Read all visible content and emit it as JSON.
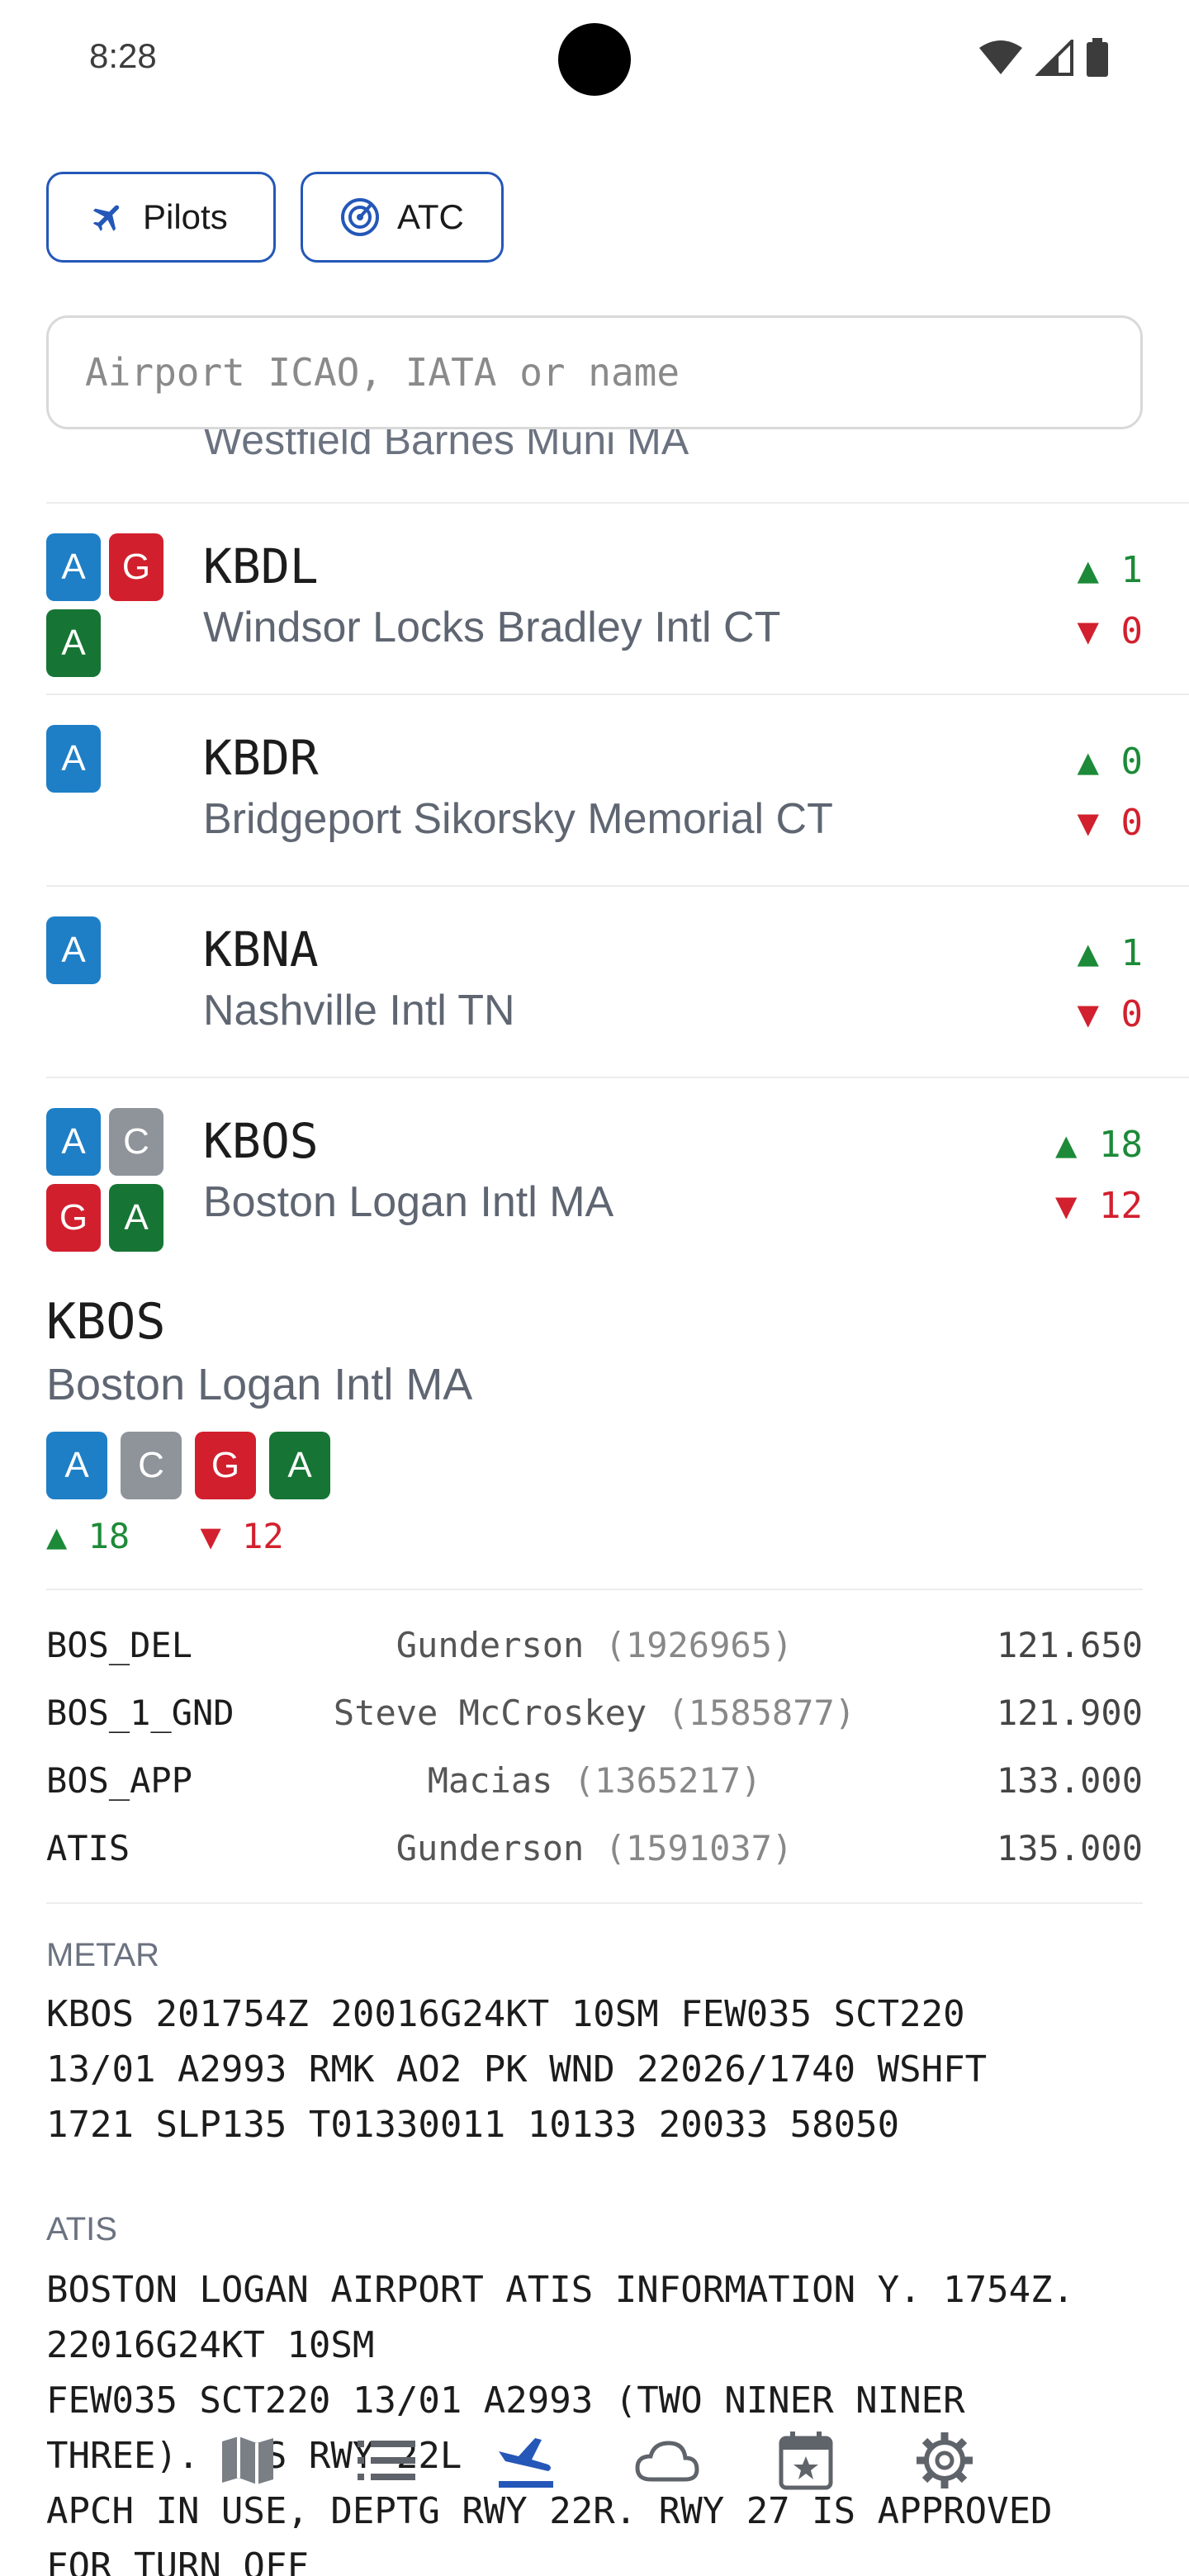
{
  "status": {
    "time": "8:28"
  },
  "toggles": {
    "pilots_label": "Pilots",
    "atc_label": "ATC"
  },
  "search": {
    "placeholder": "Airport ICAO, IATA or name"
  },
  "partial_row_text": "Westfield Barnes Muni MA",
  "airports": [
    {
      "icao": "KBDL",
      "name": "Windsor Locks Bradley Intl CT",
      "badges": [
        "A",
        "G",
        "A"
      ],
      "up": "1",
      "down": "0"
    },
    {
      "icao": "KBDR",
      "name": "Bridgeport Sikorsky Memorial CT",
      "badges": [
        "A"
      ],
      "up": "0",
      "down": "0"
    },
    {
      "icao": "KBNA",
      "name": "Nashville Intl TN",
      "badges": [
        "A"
      ],
      "up": "1",
      "down": "0"
    },
    {
      "icao": "KBOS",
      "name": "Boston Logan Intl MA",
      "badges": [
        "A",
        "C",
        "G",
        "A"
      ],
      "up": "18",
      "down": "12"
    }
  ],
  "detail": {
    "icao": "KBOS",
    "name": "Boston Logan Intl MA",
    "badges": [
      "A",
      "C",
      "G",
      "A"
    ],
    "up": "18",
    "down": "12",
    "up_arrow": "▲",
    "down_arrow": "▼",
    "controllers": [
      {
        "callsign": "BOS_DEL",
        "name": "Gunderson",
        "cid": "(1926965)",
        "freq": "121.650"
      },
      {
        "callsign": "BOS_1_GND",
        "name": "Steve McCroskey",
        "cid": "(1585877)",
        "freq": "121.900"
      },
      {
        "callsign": "BOS_APP",
        "name": "Macias",
        "cid": "(1365217)",
        "freq": "133.000"
      },
      {
        "callsign": "ATIS",
        "name": "Gunderson",
        "cid": "(1591037)",
        "freq": "135.000"
      }
    ],
    "metar_label": "METAR",
    "metar": "KBOS 201754Z 20016G24KT 10SM FEW035 SCT220\n13/01 A2993 RMK AO2 PK WND 22026/1740 WSHFT\n1721 SLP135 T01330011 10133 20033 58050",
    "atis_label": "ATIS",
    "atis": "BOSTON LOGAN AIRPORT ATIS INFORMATION Y. 1754Z.\n22016G24KT 10SM\nFEW035 SCT220 13/01 A2993 (TWO NINER NINER\nTHREE). ILS RWY 22L\nAPCH IN USE, DEPTG RWY 22R. RWY 27 IS APPROVED\nFOR TURN OFF"
  },
  "bottom_nav": {
    "items": [
      {
        "icon": "map-icon"
      },
      {
        "icon": "list-icon"
      },
      {
        "icon": "airport-icon",
        "active": true
      },
      {
        "icon": "cloud-icon"
      },
      {
        "icon": "calendar-star-icon"
      },
      {
        "icon": "gear-icon"
      }
    ]
  },
  "colors": {
    "accent": "#2457b8",
    "badge_a": "#1e7fc6",
    "badge_g": "#d21f2d",
    "badge_c": "#8f949b",
    "badge_a_green": "#167534",
    "up": "#1c8a38",
    "down": "#d2202e"
  }
}
